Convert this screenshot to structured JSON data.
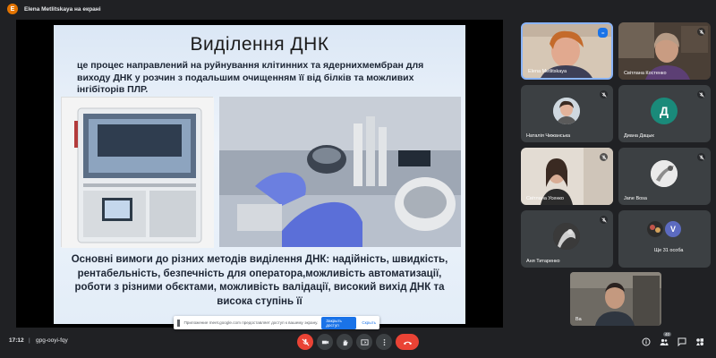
{
  "presenter": {
    "initial": "E",
    "label": "Elena Metlitskaya на екрані",
    "badge_color": "#e37400"
  },
  "slide": {
    "title": "Виділення ДНК",
    "description": "це процес направлений на руйнування клітинних та ядернихмембран для виходу ДНК у розчин з подальшим очищенням її від білків та можливих інгібіторів ПЛР.",
    "requirements": "Основні вимоги до різних методів виділення ДНК: надійність, швидкість, рентабельність, безпечність для оператора,можливість автоматизації, роботи з різними обєктами, можливість валідації, високий вихід ДНК та висока ступінь її"
  },
  "share_banner": {
    "text": "Приложение meet.google.com предоставляет доступ к вашему экрану.",
    "stop_button": "Закрыть доступ",
    "hide_link": "Скрыть"
  },
  "participants": [
    {
      "name": "Elena Metlitskaya",
      "kind": "video",
      "active": true,
      "more": "•••"
    },
    {
      "name": "Світлана Костенко",
      "kind": "video"
    },
    {
      "name": "Наталія Чижанська",
      "kind": "photo"
    },
    {
      "name": "Диана Дацык",
      "kind": "letter",
      "letter": "Д",
      "color": "#1a8a7a"
    },
    {
      "name": "Світлана Усенко",
      "kind": "video"
    },
    {
      "name": "Jane Bosa",
      "kind": "photo"
    },
    {
      "name": "Аня Титаренко",
      "kind": "photo"
    },
    {
      "name": "Ще 31 особа",
      "kind": "group",
      "letter": "V"
    },
    {
      "name": "Ва",
      "kind": "self"
    }
  ],
  "meeting": {
    "time": "17:12",
    "separator": "|",
    "code": "gpg-ooyi-fqy",
    "participant_count": "40"
  },
  "colors": {
    "background": "#202124",
    "tile": "#3c4043",
    "danger": "#ea4335",
    "accent": "#1a73e8",
    "active_border": "#8ab4f8"
  },
  "controls": [
    {
      "name": "mic-off-button",
      "icon": "mic-off-icon"
    },
    {
      "name": "camera-button",
      "icon": "camera-icon"
    },
    {
      "name": "raise-hand-button",
      "icon": "hand-icon"
    },
    {
      "name": "present-button",
      "icon": "present-icon"
    },
    {
      "name": "more-options-button",
      "icon": "more-vert-icon"
    },
    {
      "name": "leave-call-button",
      "icon": "phone-hangup-icon"
    }
  ]
}
